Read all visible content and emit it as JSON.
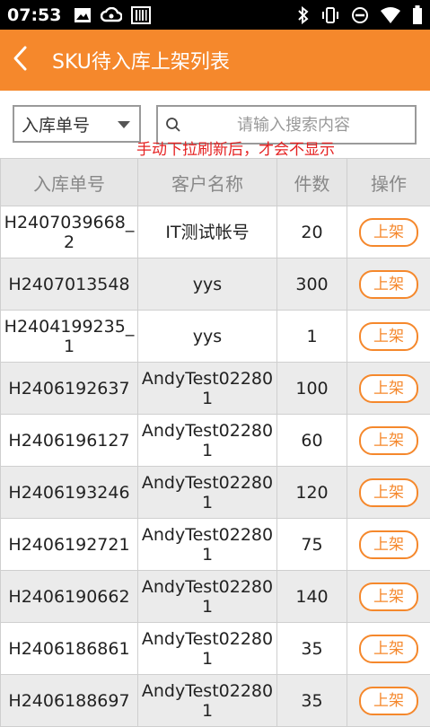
{
  "status_bar": {
    "time": "07:53",
    "left_icons": [
      "image-icon",
      "cloud-sync-icon",
      "barcode-icon"
    ],
    "right_icons": [
      "bluetooth-icon",
      "vibrate-icon",
      "do-not-disturb-icon",
      "wifi-icon",
      "battery-icon"
    ]
  },
  "header": {
    "title": "SKU待入库上架列表",
    "back_icon": "chevron-left-icon"
  },
  "filter": {
    "select_value": "入库单号",
    "search_placeholder": "请输入搜索内容",
    "hint": "手动下拉刷新后，才会不显示"
  },
  "table": {
    "columns": [
      "入库单号",
      "客户名称",
      "件数",
      "操作"
    ],
    "rows": [
      {
        "order": "H2407039668_2",
        "customer": "IT测试帐号",
        "qty": "20",
        "action": "上架"
      },
      {
        "order": "H2407013548",
        "customer": "yys",
        "qty": "300",
        "action": "上架"
      },
      {
        "order": "H2404199235_1",
        "customer": "yys",
        "qty": "1",
        "action": "上架"
      },
      {
        "order": "H2406192637",
        "customer": "AndyTest022801",
        "qty": "100",
        "action": "上架"
      },
      {
        "order": "H2406196127",
        "customer": "AndyTest022801",
        "qty": "60",
        "action": "上架"
      },
      {
        "order": "H2406193246",
        "customer": "AndyTest022801",
        "qty": "120",
        "action": "上架"
      },
      {
        "order": "H2406192721",
        "customer": "AndyTest022801",
        "qty": "75",
        "action": "上架"
      },
      {
        "order": "H2406190662",
        "customer": "AndyTest022801",
        "qty": "140",
        "action": "上架"
      },
      {
        "order": "H2406186861",
        "customer": "AndyTest022801",
        "qty": "35",
        "action": "上架"
      },
      {
        "order": "H2406188697",
        "customer": "AndyTest022801",
        "qty": "35",
        "action": "上架"
      }
    ]
  },
  "colors": {
    "accent": "#F5882C",
    "hint": "#E52222",
    "header_row": "#E6E6E6",
    "alt_row": "#EBEBEB"
  }
}
